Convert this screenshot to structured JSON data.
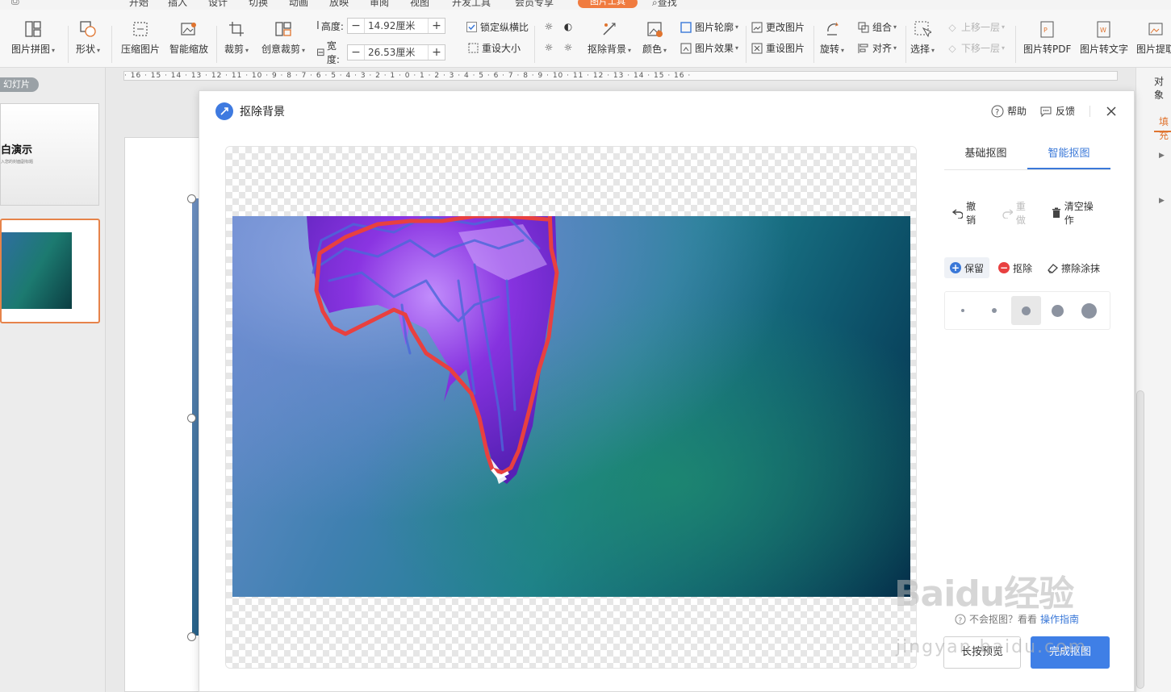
{
  "menubar": {
    "items": [
      "开始",
      "插入",
      "设计",
      "切换",
      "动画",
      "放映",
      "审阅",
      "视图",
      "开发工具",
      "会员专享"
    ],
    "active_tab": "图片工具",
    "search": "查找"
  },
  "ribbon": {
    "picture_collage": "图片拼图",
    "shape": "形状",
    "compress": "压缩图片",
    "smart_zoom": "智能缩放",
    "crop": "裁剪",
    "creative_crop": "创意裁剪",
    "height_label": "高度:",
    "height_value": "14.92厘米",
    "width_label": "宽度:",
    "width_value": "26.53厘米",
    "lock_ratio": "锁定纵横比",
    "reset_size": "重设大小",
    "remove_bg": "抠除背景",
    "color": "颜色",
    "outline": "图片轮廓",
    "effects": "图片效果",
    "change_picture": "更改图片",
    "reset_picture": "重设图片",
    "rotate": "旋转",
    "group": "组合",
    "align": "对齐",
    "select": "选择",
    "bring_forward": "上移一层",
    "send_backward": "下移一层",
    "to_pdf": "图片转PDF",
    "to_text": "图片转文字",
    "extract": "图片提取"
  },
  "ruler": "· 16 · 15 · 14 · 13 · 12 · 11 · 10 · 9 · 8 · 7 · 6 · 5 · 4 · 3 · 2 · 1 · 0 · 1 · 2 · 3 · 4 · 5 · 6 · 7 · 8 · 9 · 10 · 11 · 12 · 13 · 14 · 15 · 16 ·",
  "slides_panel": {
    "tag": "幻灯片",
    "slide1_title": "白演示",
    "slide1_sub": "入您的封面副标题"
  },
  "right_pane": {
    "title": "对象",
    "tab": "填充"
  },
  "dialog": {
    "title": "抠除背景",
    "help": "帮助",
    "feedback": "反馈",
    "tabs": [
      "基础抠图",
      "智能抠图"
    ],
    "ops": {
      "undo": "撤销",
      "redo": "重做",
      "clear": "清空操作"
    },
    "modes": {
      "keep": "保留",
      "remove": "抠除",
      "erase": "擦除涂抹"
    },
    "help_line": "不会抠图？看看",
    "help_link": "操作指南",
    "preview_button": "长按预览",
    "done_button": "完成抠图"
  },
  "watermark": {
    "main": "Baidu经验",
    "sub": "jingyan.baidu.com"
  },
  "colors": {
    "accent": "#3f7fe6",
    "keep_stroke": "#e84040",
    "remove_stroke": "#4a68d8",
    "tab_orange": "#f07b3f"
  }
}
